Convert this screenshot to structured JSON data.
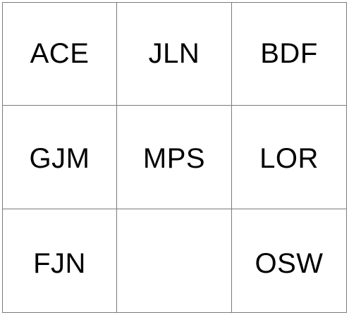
{
  "grid": {
    "cells": [
      {
        "label": "ACE"
      },
      {
        "label": "JLN"
      },
      {
        "label": "BDF"
      },
      {
        "label": "GJM"
      },
      {
        "label": "MPS"
      },
      {
        "label": "LOR"
      },
      {
        "label": "FJN"
      },
      {
        "label": ""
      },
      {
        "label": "OSW"
      }
    ]
  }
}
